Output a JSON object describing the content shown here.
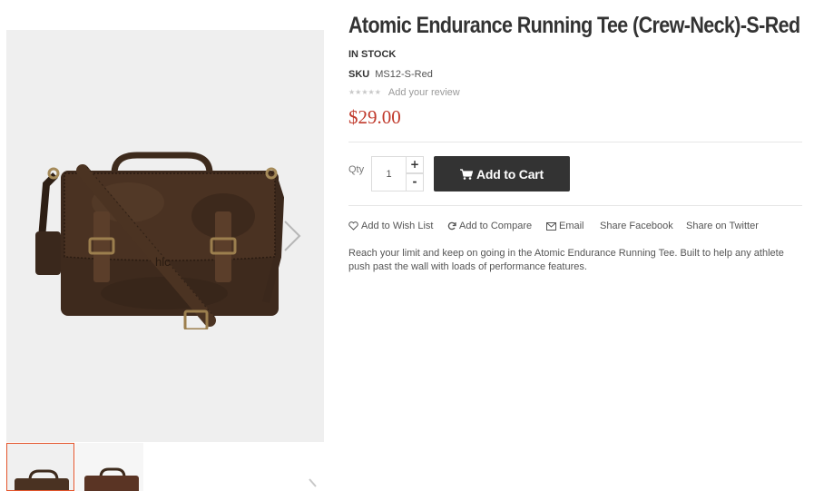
{
  "product": {
    "title": "Atomic Endurance Running Tee (Crew-Neck)-S-Red",
    "stock_status": "IN STOCK",
    "sku_label": "SKU",
    "sku_value": "MS12-S-Red",
    "rating_stars": "★★★★★",
    "review_link": "Add your review",
    "price": "$29.00",
    "description": "Reach your limit and keep on going in the Atomic Endurance Running Tee. Built to help any athlete push past the wall with loads of performance features."
  },
  "gallery": {
    "image_logo_text": "hlc",
    "thumbnails": [
      "thumb-1",
      "thumb-2"
    ]
  },
  "cart": {
    "qty_label": "Qty",
    "qty_value": "1",
    "plus_label": "+",
    "minus_label": "-",
    "add_to_cart_label": "Add to Cart"
  },
  "actions": {
    "wishlist": "Add to Wish List",
    "compare": "Add to Compare",
    "email": "Email",
    "share_facebook": "Share Facebook",
    "share_twitter": "Share on Twitter"
  },
  "colors": {
    "price": "#c0392b",
    "cart_button": "#333333",
    "active_thumb_border": "#e4552c",
    "gallery_bg": "#efefef"
  },
  "icons": {
    "next": "chevron-right-icon",
    "cart": "shopping-cart-icon",
    "wishlist": "heart-icon",
    "compare": "refresh-icon",
    "email": "envelope-icon"
  }
}
